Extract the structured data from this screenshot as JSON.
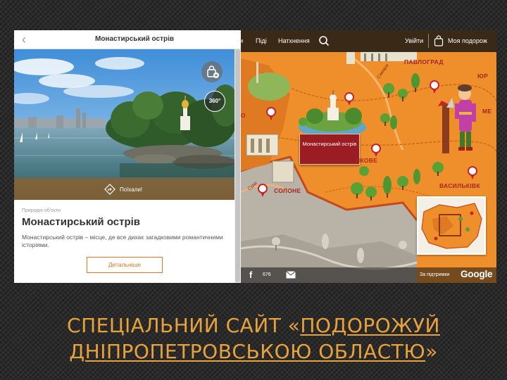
{
  "panel": {
    "back_icon": "chevron-left-icon",
    "title": "Монастирський острів",
    "save_icon": "bag-plus-icon",
    "pano_label": "360°",
    "go_label": "Поїхали!",
    "category": "Природні об'єкти",
    "place_title": "Монастирський острів",
    "description": "Монастирський острів – місце, де все дихає загадковими романтичними історіями.",
    "details_button": "Детальніше"
  },
  "map": {
    "nav": {
      "item1": "ти",
      "item2": "Піді",
      "item3": "Натхнення",
      "search_icon": "search-icon",
      "login": "Увійти",
      "bag_icon": "bag-icon",
      "trip": "Моя подорож"
    },
    "selected_popup": "Монастирський острів",
    "towns": {
      "pavlohrad": "ПАВЛОГРАД",
      "yuryivka": "ЮР",
      "mezheva": "МЕ",
      "vasylkivka": "ВАСИЛЬКІВК",
      "solone": "СОЛОНЕ",
      "mahdalynivka": "РО",
      "petrykivka": "ИКОВЕ"
    },
    "rivers": {
      "samara": "Самара",
      "sura": "Сура"
    },
    "footer": {
      "facebook_icon": "f",
      "share_count": "676",
      "email_icon": "envelope-icon",
      "support": "За підтримки",
      "google": "Google"
    }
  },
  "slide_title": {
    "line1_plain": "СПЕЦІАЛЬНИЙ САЙТ «",
    "line1_link": "ПОДОРОЖУЙ",
    "line2_link": "ДНІПРОПЕТРОВСЬКОЮ ОБЛАСТЮ",
    "line2_plain": "»"
  },
  "colors": {
    "accent": "#e8731f",
    "map_orange": "#ee8f2c",
    "popup_red": "#9b1c22",
    "title_gold": "#e8a23c"
  }
}
